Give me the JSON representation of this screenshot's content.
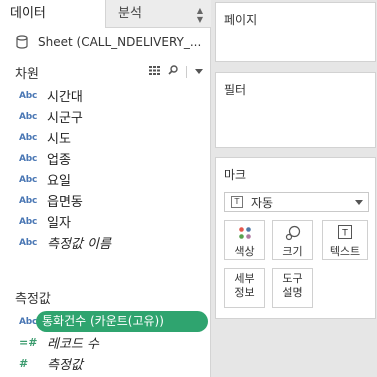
{
  "tabs": {
    "data": "데이터",
    "analytics": "분석"
  },
  "source": {
    "label": "Sheet (CALL_NDELIVERY_..."
  },
  "dimensions": {
    "title": "차원",
    "fields": [
      "시간대",
      "시군구",
      "시도",
      "업종",
      "요일",
      "읍면동",
      "일자",
      "측정값 이름"
    ],
    "type_label": "Abc"
  },
  "measures": {
    "title": "측정값",
    "pill": "통화건수 (카운트(고유))",
    "record_count": "레코드 수",
    "measure_values": "측정값",
    "type_label": "Abc"
  },
  "cards": {
    "pages": "페이지",
    "filters": "필터",
    "marks": "마크",
    "mark_type": "자동",
    "buttons": {
      "color": "색상",
      "size": "크기",
      "text": "텍스트",
      "detail": "세부\n정보",
      "tooltip": "도구\n설명"
    }
  }
}
